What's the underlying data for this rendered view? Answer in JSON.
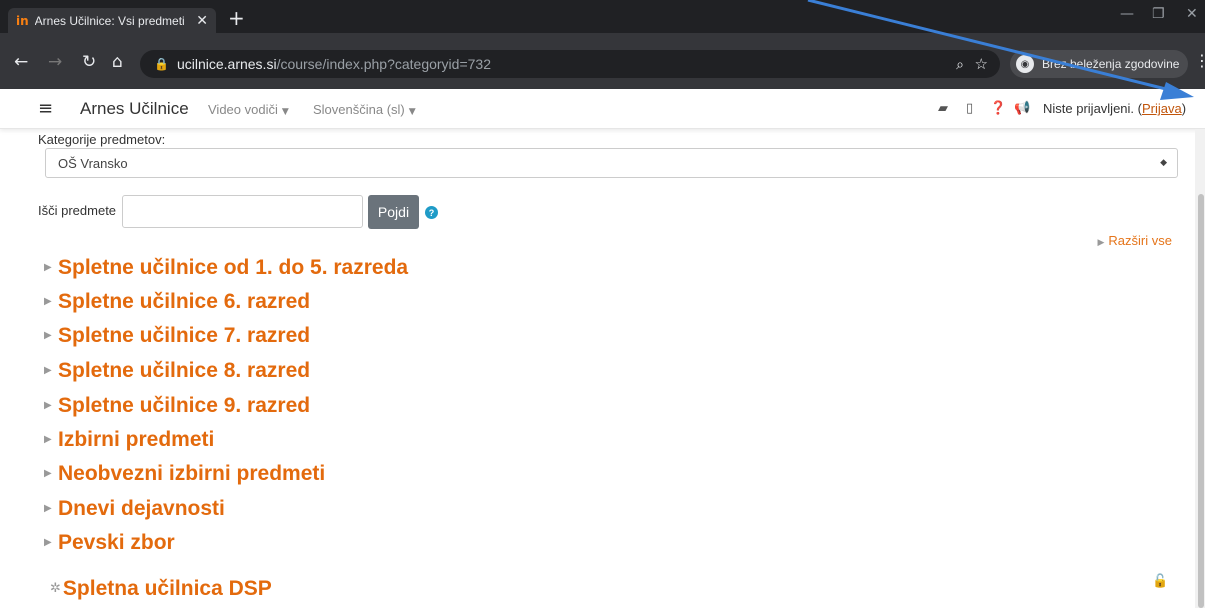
{
  "browser": {
    "tab_title": "Arnes Učilnice: Vsi predmeti",
    "tab_favicon": "in",
    "url_host": "ucilnice.arnes.si",
    "url_path": "/course/index.php?categoryid=732",
    "incognito_label": "Brez beleženja zgodovine"
  },
  "navbar": {
    "brand": "Arnes Učilnice",
    "video_guides": "Video vodiči",
    "language": "Slovenščina (sl)",
    "not_logged_in": "Niste prijavljeni. (",
    "login_link": "Prijava",
    "close_paren": ")"
  },
  "main": {
    "category_label": "Kategorije predmetov:",
    "category_selected": "OŠ Vransko",
    "search_label": "Išči predmete",
    "search_value": "",
    "go_button": "Pojdi",
    "expand_all": "Razširi vse",
    "categories": [
      "Spletne učilnice od 1. do 5. razreda",
      "Spletne učilnice 6. razred",
      "Spletne učilnice 7. razred",
      "Spletne učilnice 8. razred",
      "Spletne učilnice 9. razred",
      "Izbirni predmeti",
      "Neobvezni izbirni predmeti",
      "Dnevi dejavnosti",
      "Pevski zbor"
    ],
    "course": "Spletna učilnica DSP"
  },
  "colors": {
    "accent": "#e36a0d",
    "arrow": "#3a7fd6"
  }
}
